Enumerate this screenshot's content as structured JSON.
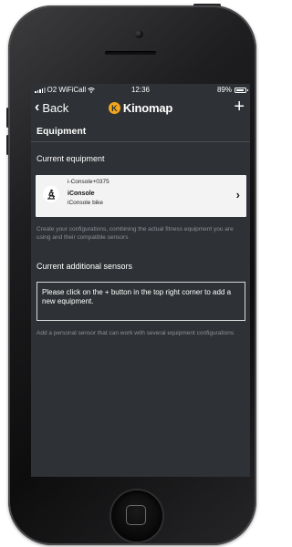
{
  "status_bar": {
    "carrier": "O2 WiFiCall",
    "time": "12:36",
    "battery": "89%",
    "battery_level": 0.89
  },
  "nav": {
    "back_label": "Back",
    "logo_text": "Kinomap",
    "logo_mark": "K",
    "add_label": "+"
  },
  "page": {
    "title": "Equipment"
  },
  "current_equipment": {
    "heading": "Current equipment",
    "card": {
      "id_line": "i-Console+0375",
      "name": "iConsole",
      "type": "iConsole bike",
      "icon": "exercise-bike-icon"
    },
    "help": "Create your configurations, combining the actual fitness equipment you are using and their compatible sensors"
  },
  "additional_sensors": {
    "heading": "Current additional sensors",
    "empty_message": "Please click on the + button in the top right corner to add a new equipment.",
    "help": "Add a personal sensor that can work with several equipment configurations"
  },
  "colors": {
    "screen_bg": "#2e3135",
    "card_bg": "#f3f3f3",
    "help_text": "#8d9197",
    "brand_accent": "#f2a71b"
  }
}
